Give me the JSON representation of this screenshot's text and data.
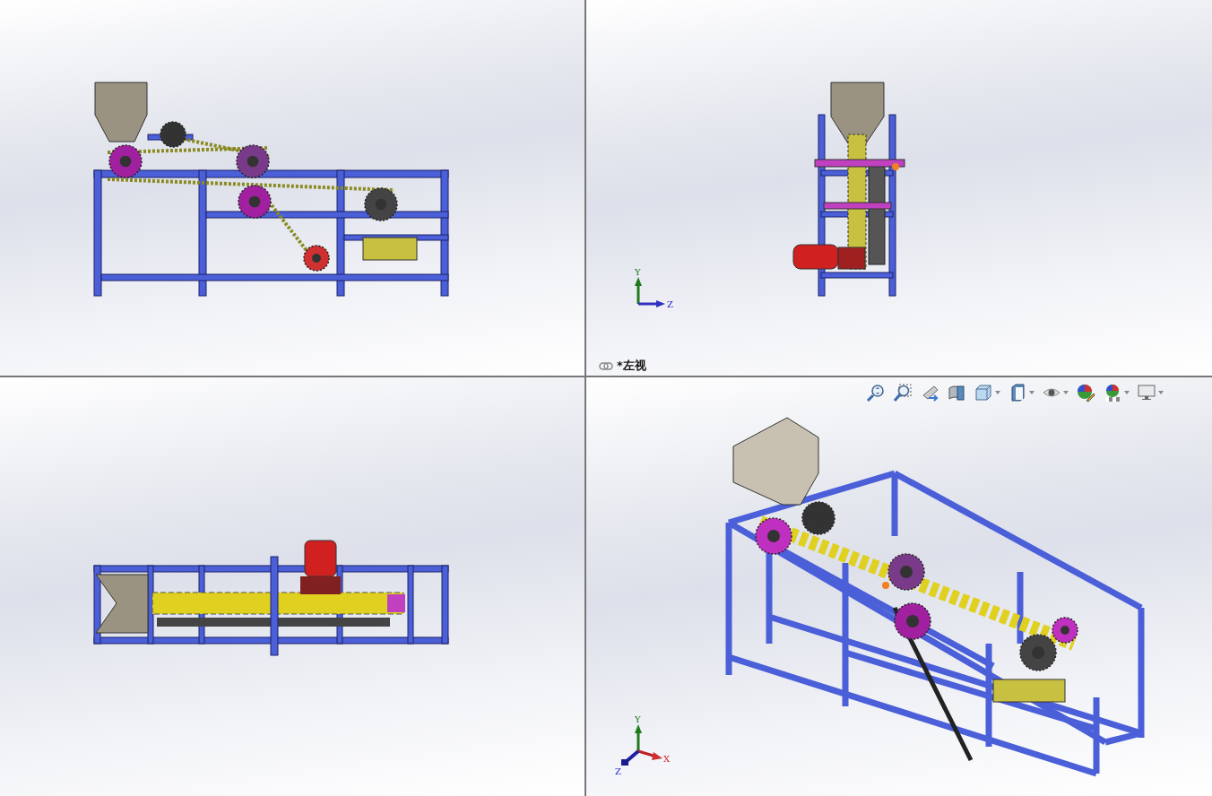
{
  "viewports": [
    {
      "kind": "front"
    },
    {
      "kind": "side",
      "triad": {
        "kind": "yz",
        "axes": [
          "Y",
          "Z"
        ]
      },
      "label": "*左视"
    },
    {
      "kind": "top"
    },
    {
      "kind": "iso",
      "triad": {
        "kind": "xyz",
        "axes": [
          "Y",
          "X",
          "Z"
        ]
      },
      "toolbar": [
        {
          "kind": "zoom-fit",
          "dropdown": false
        },
        {
          "kind": "zoom-area",
          "dropdown": false
        },
        {
          "kind": "previous",
          "dropdown": false
        },
        {
          "kind": "section",
          "dropdown": false
        },
        {
          "kind": "orientation",
          "dropdown": true
        },
        {
          "kind": "display",
          "dropdown": true
        },
        {
          "kind": "eye",
          "dropdown": true
        },
        {
          "kind": "appearance",
          "dropdown": false
        },
        {
          "kind": "scene",
          "dropdown": true
        },
        {
          "kind": "monitor",
          "dropdown": true
        }
      ]
    }
  ]
}
